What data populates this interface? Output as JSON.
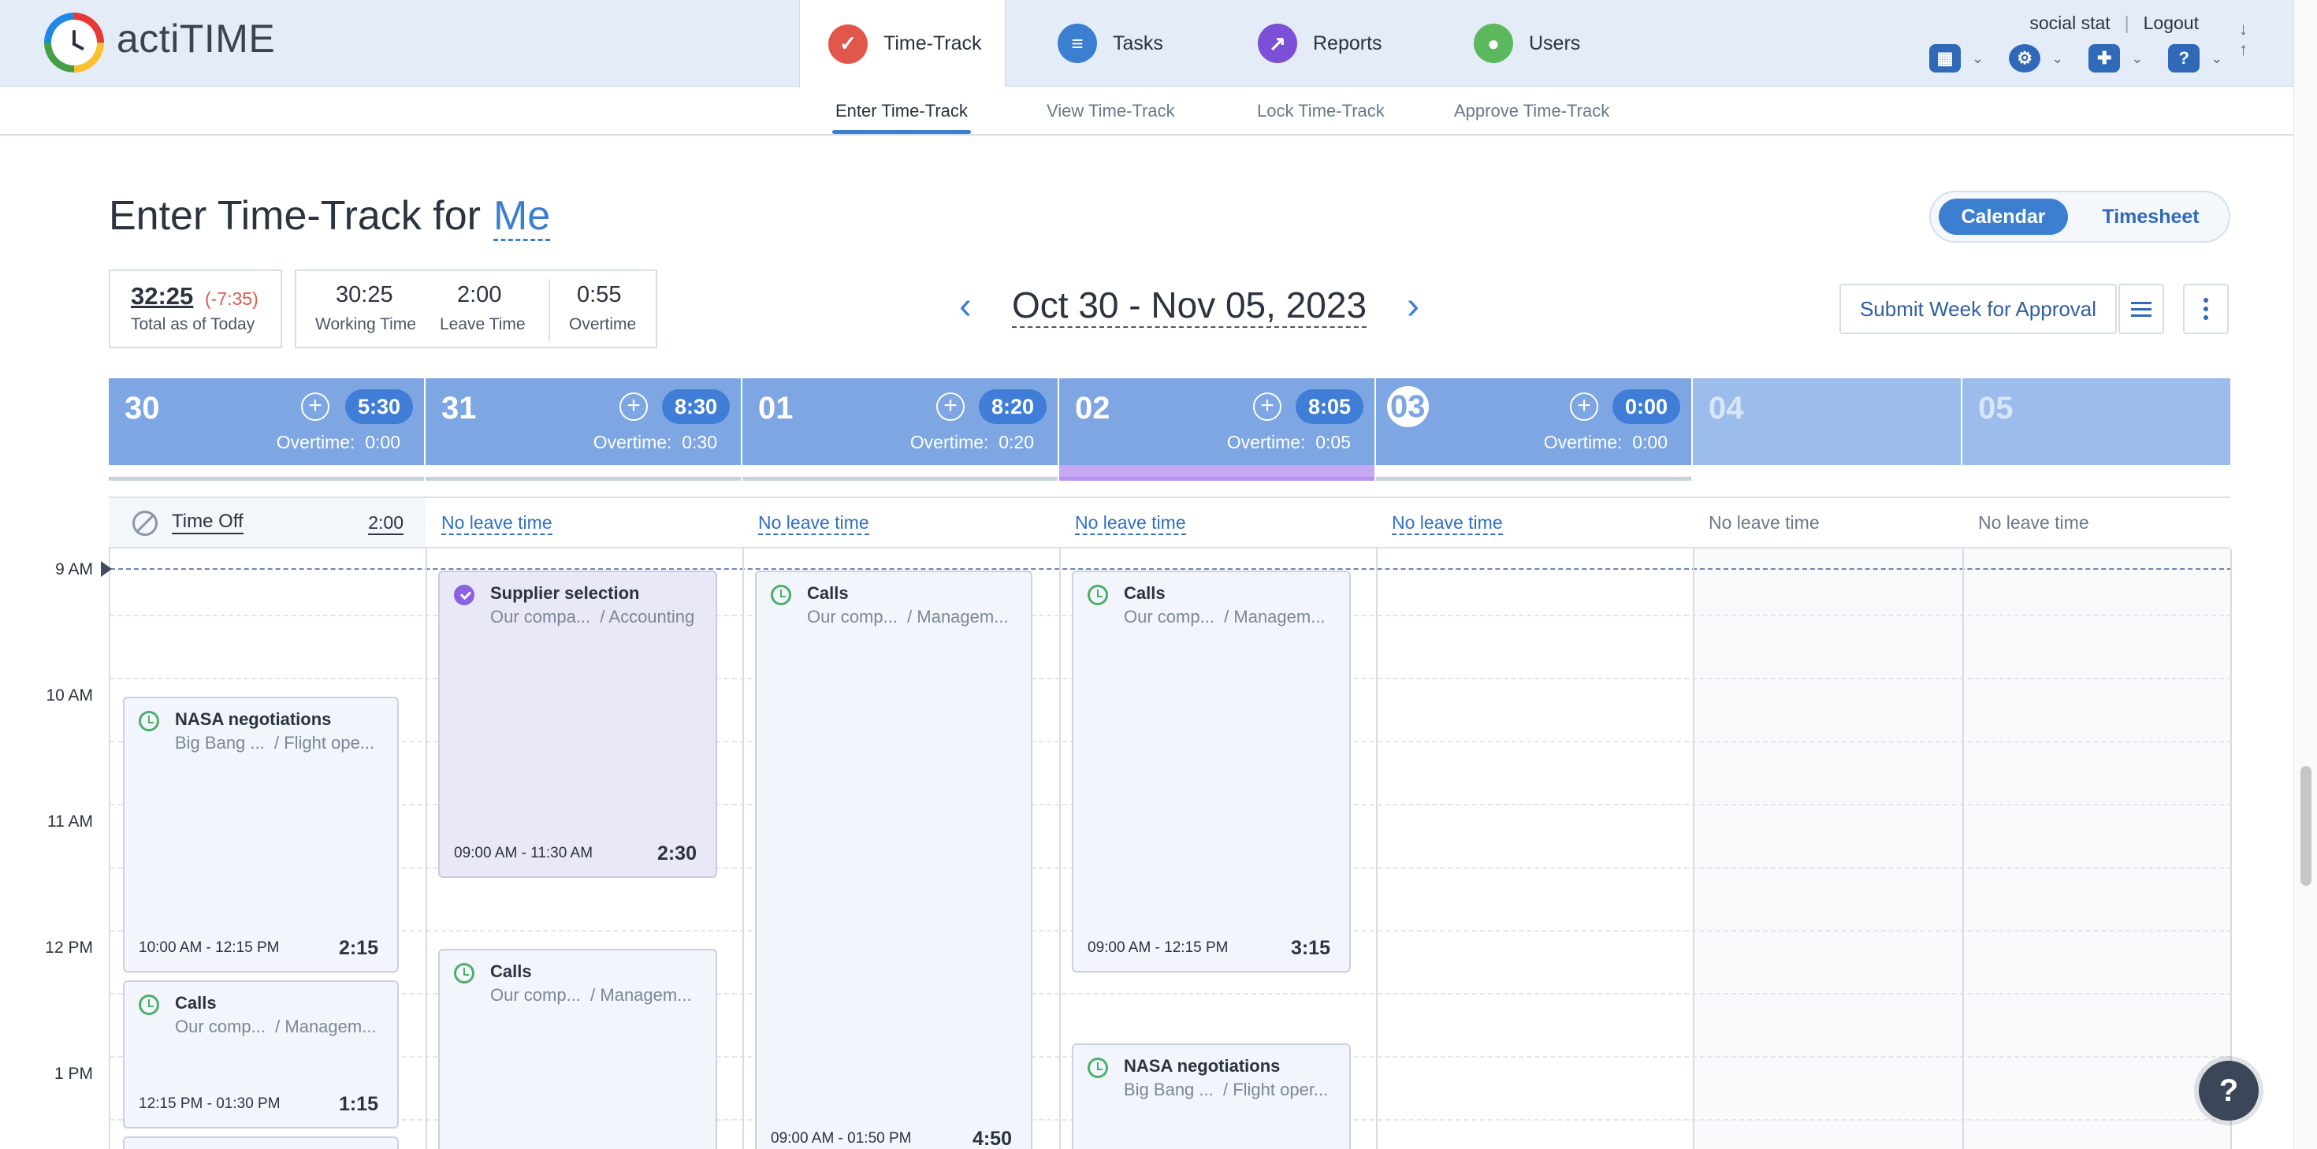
{
  "app": {
    "brand": "actiTIME",
    "colors": {
      "accent": "#3c7fd1",
      "header_blue": "#7da6e3",
      "header_empty": "#9cbcec",
      "negative": "#e2574c",
      "approved_purple": "#8b63de"
    }
  },
  "nav": {
    "tabs": [
      {
        "label": "Time-Track",
        "icon": "check-icon",
        "color": "#e2574c"
      },
      {
        "label": "Tasks",
        "icon": "list-icon",
        "color": "#3c7fd1"
      },
      {
        "label": "Reports",
        "icon": "chart-icon",
        "color": "#7b4fd6"
      },
      {
        "label": "Users",
        "icon": "user-icon",
        "color": "#5cb85c"
      }
    ],
    "user_name": "social stat",
    "logout": "Logout",
    "subtabs": [
      "Enter Time-Track",
      "View Time-Track",
      "Lock Time-Track",
      "Approve Time-Track"
    ]
  },
  "page": {
    "title": "Enter Time-Track for",
    "for_user": "Me",
    "view_toggle": {
      "calendar": "Calendar",
      "timesheet": "Timesheet",
      "selected": "Calendar"
    }
  },
  "totals": {
    "total_value": "32:25",
    "total_diff": "(-7:35)",
    "total_label": "Total as of Today",
    "working_value": "30:25",
    "working_label": "Working Time",
    "leave_value": "2:00",
    "leave_label": "Leave Time",
    "overtime_value": "0:55",
    "overtime_label": "Overtime"
  },
  "week": {
    "range": "Oct 30 - Nov 05, 2023",
    "prev_icon": "chevron-left-icon",
    "next_icon": "chevron-right-icon",
    "submit_label": "Submit Week for Approval"
  },
  "days": [
    {
      "num": "30",
      "total": "5:30",
      "overtime_label": "Overtime:",
      "overtime": "0:00",
      "leave": "Time Off",
      "leave_value": "2:00"
    },
    {
      "num": "31",
      "total": "8:30",
      "overtime_label": "Overtime:",
      "overtime": "0:30",
      "leave": "No leave time"
    },
    {
      "num": "01",
      "total": "8:20",
      "overtime_label": "Overtime:",
      "overtime": "0:20",
      "leave": "No leave time"
    },
    {
      "num": "02",
      "total": "8:05",
      "overtime_label": "Overtime:",
      "overtime": "0:05",
      "leave": "No leave time"
    },
    {
      "num": "03",
      "total": "0:00",
      "overtime_label": "Overtime:",
      "overtime": "0:00",
      "leave": "No leave time",
      "today": true
    },
    {
      "num": "04",
      "leave": "No leave time"
    },
    {
      "num": "05",
      "leave": "No leave time"
    }
  ],
  "hours": [
    "9 AM",
    "10 AM",
    "11 AM",
    "12 PM",
    "1 PM"
  ],
  "events": [
    {
      "day": 0,
      "title": "NASA negotiations",
      "customer": "Big Bang ...",
      "project": "/ Flight ope...",
      "time": "10:00 AM - 12:15 PM",
      "duration": "2:15",
      "status": "tracked"
    },
    {
      "day": 0,
      "title": "Calls",
      "customer": "Our comp...",
      "project": "/ Managem...",
      "time": "12:15 PM - 01:30 PM",
      "duration": "1:15",
      "status": "tracked"
    },
    {
      "day": 1,
      "title": "Supplier selection",
      "customer": "Our compa...",
      "project": "/ Accounting",
      "time": "09:00 AM - 11:30 AM",
      "duration": "2:30",
      "status": "approved"
    },
    {
      "day": 1,
      "title": "Calls",
      "customer": "Our comp...",
      "project": "/ Managem...",
      "status": "tracked"
    },
    {
      "day": 2,
      "title": "Calls",
      "customer": "Our comp...",
      "project": "/ Managem...",
      "time": "09:00 AM - 01:50 PM",
      "duration": "4:50",
      "status": "tracked"
    },
    {
      "day": 3,
      "title": "Calls",
      "customer": "Our comp...",
      "project": "/ Managem...",
      "time": "09:00 AM - 12:15 PM",
      "duration": "3:15",
      "status": "tracked"
    },
    {
      "day": 3,
      "title": "NASA negotiations",
      "customer": "Big Bang ...",
      "project": "/ Flight oper...",
      "status": "tracked"
    }
  ],
  "help": "?"
}
